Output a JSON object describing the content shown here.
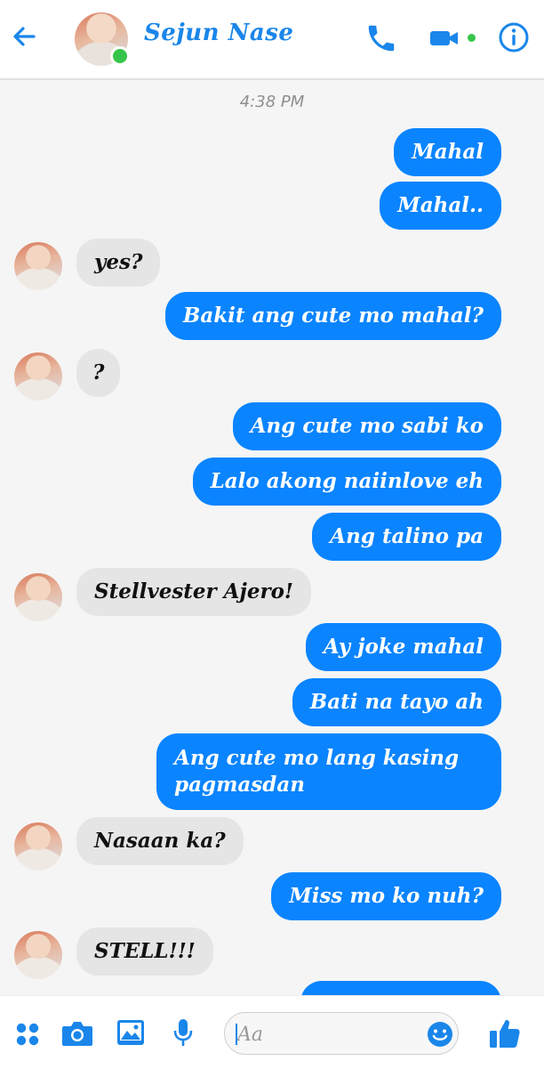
{
  "header": {
    "name": "Sejun Nase",
    "colors": {
      "accent": "#1a86ea",
      "online": "#36c54a"
    }
  },
  "timestamp": "4:38 PM",
  "messages": [
    {
      "from": "me",
      "text": "Mahal"
    },
    {
      "from": "me",
      "text": "Mahal.."
    },
    {
      "from": "them",
      "text": "yes?"
    },
    {
      "from": "me",
      "text": "Bakit ang cute mo mahal?"
    },
    {
      "from": "them",
      "text": "?"
    },
    {
      "from": "me",
      "text": "Ang cute mo sabi ko"
    },
    {
      "from": "me",
      "text": "Lalo akong naiinlove eh"
    },
    {
      "from": "me",
      "text": "Ang talino pa"
    },
    {
      "from": "them",
      "text": "Stellvester Ajero!"
    },
    {
      "from": "me",
      "text": "Ay joke mahal"
    },
    {
      "from": "me",
      "text": "Bati na tayo ah"
    },
    {
      "from": "me",
      "text": "Ang cute mo lang kasing pagmasdan"
    },
    {
      "from": "them",
      "text": "Nasaan ka?"
    },
    {
      "from": "me",
      "text": "Miss mo ko nuh?"
    },
    {
      "from": "them",
      "text": "STELL!!!"
    }
  ],
  "composer": {
    "placeholder": "Aa",
    "icons": [
      "apps-grid-icon",
      "camera-icon",
      "image-icon",
      "microphone-icon",
      "emoji-icon",
      "thumbs-up-icon"
    ]
  }
}
